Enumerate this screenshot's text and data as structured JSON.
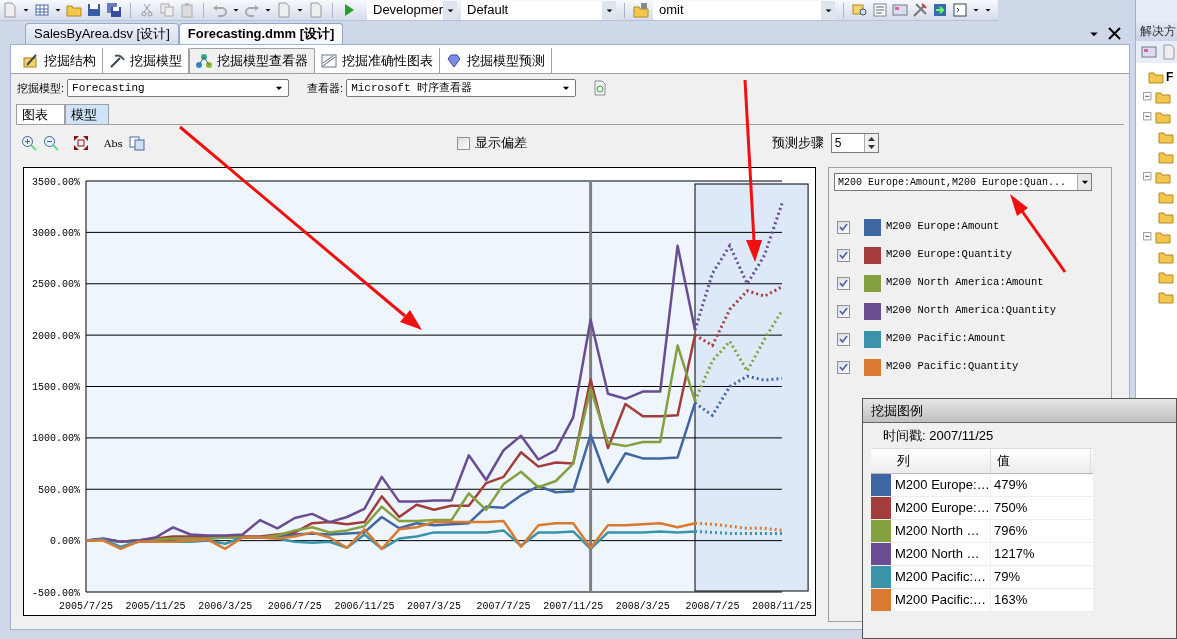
{
  "toolbar": {
    "combos": [
      {
        "value": "Developmer"
      },
      {
        "value": "Default"
      },
      {
        "value": "omit"
      }
    ]
  },
  "document_tabs": [
    {
      "label": "SalesByArea.dsv [设计]",
      "selected": false
    },
    {
      "label": "Forecasting.dmm [设计]",
      "selected": true
    }
  ],
  "designer_tabs": [
    {
      "label": "挖掘结构",
      "selected": false
    },
    {
      "label": "挖掘模型",
      "selected": false
    },
    {
      "label": "挖掘模型查看器",
      "selected": true
    },
    {
      "label": "挖掘准确性图表",
      "selected": false
    },
    {
      "label": "挖掘模型预测",
      "selected": false
    }
  ],
  "model_field": {
    "label": "挖掘模型:",
    "value": "Forecasting"
  },
  "viewer_field": {
    "label": "查看器:",
    "value": "Microsoft 时序查看器"
  },
  "view_tabs": [
    {
      "label": "图表",
      "selected": true
    },
    {
      "label": "模型",
      "selected": false
    }
  ],
  "chart_toolbar": {
    "abs_button": "Abs",
    "show_deviation": {
      "label": "显示偏差",
      "checked": false
    },
    "prediction_steps": {
      "label": "预测步骤",
      "value": "5"
    }
  },
  "chart": {
    "chart_data": {
      "type": "line",
      "categories": [
        "2005/7/25",
        null,
        null,
        null,
        "2005/11/25",
        null,
        null,
        null,
        "2006/3/25",
        null,
        null,
        null,
        "2006/7/25",
        null,
        null,
        null,
        "2006/11/25",
        null,
        null,
        null,
        "2007/3/25",
        null,
        null,
        null,
        "2007/7/25",
        null,
        null,
        null,
        "2007/11/25",
        null,
        null,
        null,
        "2008/3/25",
        null,
        null,
        null,
        "2008/7/25",
        null,
        null,
        null,
        "2008/11/25"
      ],
      "series": [
        {
          "name": "M200 Europe:Amount",
          "color": "#3f67a3",
          "values": [
            0,
            10,
            -10,
            0,
            10,
            20,
            20,
            20,
            30,
            30,
            30,
            40,
            60,
            70,
            60,
            70,
            80,
            230,
            120,
            170,
            150,
            160,
            170,
            330,
            320,
            440,
            530,
            470,
            480,
            1030,
            570,
            850,
            800,
            800,
            810,
            1340,
            1220,
            1500,
            1600,
            1560,
            1580
          ]
        },
        {
          "name": "M200 Europe:Quantity",
          "color": "#a33d3b",
          "values": [
            0,
            10,
            -10,
            0,
            20,
            40,
            40,
            40,
            40,
            40,
            40,
            60,
            80,
            170,
            180,
            160,
            180,
            430,
            230,
            350,
            300,
            340,
            340,
            560,
            620,
            860,
            720,
            760,
            750,
            1570,
            900,
            1330,
            1210,
            1210,
            1220,
            2000,
            1900,
            2250,
            2430,
            2380,
            2470
          ]
        },
        {
          "name": "M200 North America:Amount",
          "color": "#84a040",
          "values": [
            0,
            10,
            -10,
            0,
            10,
            20,
            20,
            20,
            30,
            30,
            30,
            50,
            100,
            130,
            80,
            100,
            140,
            330,
            190,
            190,
            200,
            200,
            460,
            300,
            550,
            670,
            520,
            580,
            750,
            1480,
            950,
            920,
            960,
            960,
            1900,
            1360,
            1750,
            1940,
            1650,
            1960,
            2240
          ]
        },
        {
          "name": "M200 North America:Quantity",
          "color": "#6a4c93",
          "values": [
            0,
            20,
            -10,
            0,
            30,
            130,
            60,
            50,
            50,
            60,
            200,
            120,
            220,
            260,
            180,
            230,
            310,
            620,
            380,
            380,
            390,
            390,
            830,
            590,
            880,
            1020,
            790,
            880,
            1200,
            2150,
            1430,
            1380,
            1450,
            1450,
            2870,
            2050,
            2600,
            2870,
            2500,
            2780,
            3280
          ]
        },
        {
          "name": "M200 Pacific:Amount",
          "color": "#3a93a8",
          "values": [
            0,
            10,
            -60,
            -10,
            -10,
            -10,
            -10,
            0,
            -30,
            30,
            30,
            20,
            -10,
            -20,
            -10,
            -70,
            60,
            -80,
            20,
            40,
            80,
            80,
            80,
            80,
            100,
            -50,
            80,
            80,
            90,
            -80,
            80,
            80,
            80,
            90,
            80,
            90,
            80,
            70,
            70,
            70,
            70
          ]
        },
        {
          "name": "M200 Pacific:Quantity",
          "color": "#d97a33",
          "values": [
            0,
            0,
            -80,
            -10,
            -10,
            -10,
            0,
            10,
            -80,
            30,
            30,
            20,
            40,
            80,
            30,
            -70,
            110,
            -80,
            110,
            130,
            180,
            180,
            180,
            180,
            190,
            -60,
            150,
            170,
            170,
            -70,
            150,
            150,
            160,
            170,
            130,
            170,
            160,
            140,
            120,
            120,
            100
          ]
        }
      ],
      "ylim": [
        -500,
        3500
      ],
      "yticks": [
        {
          "value": 3500,
          "label": "3500.00%"
        },
        {
          "value": 3000,
          "label": "3000.00%"
        },
        {
          "value": 2500,
          "label": "2500.00%"
        },
        {
          "value": 2000,
          "label": "2000.00%"
        },
        {
          "value": 1500,
          "label": "1500.00%"
        },
        {
          "value": 1000,
          "label": "1000.00%"
        },
        {
          "value": 500,
          "label": "500.00%"
        },
        {
          "value": 0,
          "label": "0.00%"
        },
        {
          "value": -500,
          "label": "-500.00%"
        }
      ],
      "grid": true
    }
  },
  "series_selector": {
    "value": "M200 Europe:Amount,M200 Europe:Quan..."
  },
  "legend": [
    {
      "checked": true
    },
    {
      "checked": true
    },
    {
      "checked": true
    },
    {
      "checked": true
    },
    {
      "checked": true
    },
    {
      "checked": true
    }
  ],
  "mining_legend": {
    "title": "挖掘图例",
    "timestamp": "时间戳: 2007/11/25",
    "columns": [
      "列",
      "值"
    ],
    "rows": [
      {
        "name": "M200 Europe:…",
        "value": "479%",
        "color": "#3f67a3"
      },
      {
        "name": "M200 Europe:…",
        "value": "750%",
        "color": "#a33d3b"
      },
      {
        "name": "M200 North …",
        "value": "796%",
        "color": "#84a040"
      },
      {
        "name": "M200 North …",
        "value": "1217%",
        "color": "#6a4c93"
      },
      {
        "name": "M200 Pacific:…",
        "value": "79%",
        "color": "#3a93a8"
      },
      {
        "name": "M200 Pacific:…",
        "value": "163%",
        "color": "#d97a33"
      }
    ]
  },
  "solution_explorer": {
    "title": "解决方",
    "root_item": "F"
  }
}
